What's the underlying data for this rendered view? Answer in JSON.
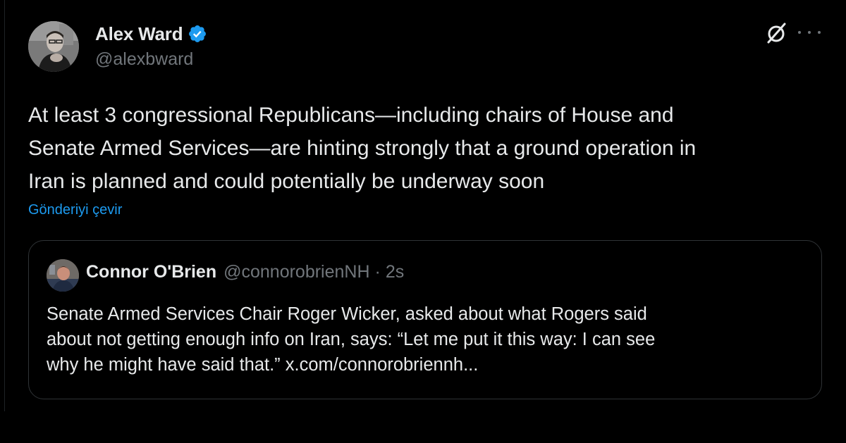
{
  "tweet": {
    "author": {
      "name": "Alex Ward",
      "handle": "@alexbward",
      "verified": true,
      "verified_color": "#1d9bf0"
    },
    "icons": {
      "grok": "grok-icon",
      "more": "more-icon"
    },
    "text_lines": [
      "At least 3 congressional Republicans—including chairs of House and",
      "Senate Armed Services—are hinting strongly that a ground operation in",
      "Iran is planned and could potentially be underway soon"
    ],
    "translate_label": "Gönderiyi çevir",
    "quote": {
      "name": "Connor O'Brien",
      "handle": "@connorobrienNH",
      "separator": "·",
      "time": "2s",
      "text_lines": [
        "Senate Armed Services Chair Roger Wicker, asked about what Rogers said",
        "about not getting enough info on Iran, says: “Let me put it this way: I can see",
        "why he might have said that.” x.com/connorobriennh..."
      ]
    }
  },
  "colors": {
    "background": "#000000",
    "primary_text": "#e7e9ea",
    "secondary_text": "#71767b",
    "link": "#1d9bf0",
    "border": "#2f3336"
  }
}
